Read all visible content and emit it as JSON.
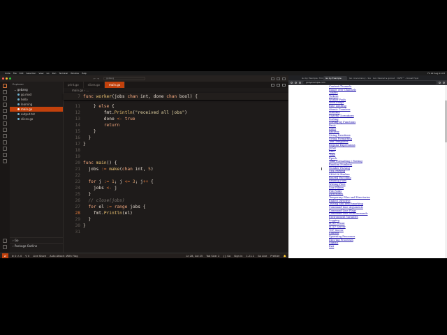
{
  "menubar": {
    "items": [
      "Code",
      "File",
      "Edit",
      "Selection",
      "View",
      "Go",
      "Run",
      "Terminal",
      "Window",
      "Help"
    ],
    "right": [
      "Fri 22 Aug 11:03"
    ]
  },
  "vscode": {
    "nav": "← →",
    "search_placeholder": "gobang",
    "sidebar": {
      "header": "Explorer",
      "folder": "gobang",
      "files": [
        {
          "name": "go.mod",
          "selected": false
        },
        {
          "name": "hello",
          "selected": false
        },
        {
          "name": "learning",
          "selected": false
        },
        {
          "name": "main.go",
          "selected": true
        },
        {
          "name": "output.txt",
          "selected": false
        },
        {
          "name": "slices.go",
          "selected": false
        }
      ],
      "go_section": "Go",
      "outline_section": "Package Outline"
    },
    "tabs": [
      {
        "label": "print.go",
        "active": false
      },
      {
        "label": "slices.go",
        "active": false
      },
      {
        "label": "main.go",
        "active": true
      }
    ],
    "breadcrumb": "main.go › ...",
    "code_lines": [
      {
        "n": "7",
        "html": "<span class='kw'>func</span> <span class='fn'>worker</span>(jobs <span class='kw'>chan</span> int, done <span class='kw'>chan</span> bool) {"
      },
      {
        "n": "11",
        "html": "    } <span class='kw'>else</span> {"
      },
      {
        "n": "12",
        "html": "        fmt.<span class='fn'>Println</span>(<span class='str'>\"received all jobs\"</span>)"
      },
      {
        "n": "13",
        "html": "        done <span class='op'>&lt;-</span> <span class='kw'>true</span>"
      },
      {
        "n": "14",
        "html": "        <span class='kw'>return</span>"
      },
      {
        "n": "15",
        "html": "    }"
      },
      {
        "n": "16",
        "html": "  }"
      },
      {
        "n": "17",
        "html": "}"
      },
      {
        "n": "18",
        "html": ""
      },
      {
        "n": "19",
        "html": ""
      },
      {
        "n": "20",
        "html": "<span class='kw'>func</span> <span class='fn'>main</span>() {"
      },
      {
        "n": "21",
        "html": "  jobs <span class='op'>:=</span> <span class='fn'>make</span>(<span class='kw'>chan</span> int, <span class='num'>5</span>)"
      },
      {
        "n": "22",
        "html": ""
      },
      {
        "n": "23",
        "html": "  <span class='kw'>for</span> j <span class='op'>:=</span> <span class='num'>1</span>; j <span class='op'>&lt;=</span> <span class='num'>3</span>; j<span class='op'>++</span> {"
      },
      {
        "n": "24",
        "html": "    jobs <span class='op'>&lt;-</span> j"
      },
      {
        "n": "25",
        "html": "  }"
      },
      {
        "n": "26",
        "html": "  <span class='cm'>// close(jobs)</span>"
      },
      {
        "n": "27",
        "html": "  <span class='kw'>for</span> el <span class='op'>:=</span> <span class='kw'>range</span> jobs {"
      },
      {
        "n": "28",
        "html": "    fmt.<span class='fn'>Println</span>(el)"
      },
      {
        "n": "29",
        "html": "  }"
      },
      {
        "n": "30",
        "html": "}"
      },
      {
        "n": "31",
        "html": ""
      }
    ],
    "current_line": "28",
    "status": {
      "left": [
        "⊗ 0 ⚠ 0",
        "⚲ 0",
        "Live Share",
        "Auto Attach: With Flag"
      ],
      "right": [
        "Ln 28, Col 25",
        "Tab Size: 2",
        "{} Go",
        "Sign in",
        "1.21.1",
        "Go Live",
        "Prettier"
      ]
    }
  },
  "browser": {
    "tabs": [
      {
        "label": "Go by Example: Timers",
        "active": false
      },
      {
        "label": "Go by Example",
        "active": true
      },
      {
        "label": "Go concurrency - Sonia Ka",
        "active": false
      },
      {
        "label": "Go channel & goroutine",
        "active": false
      },
      {
        "label": "YAIFE™ - Knowit Syste",
        "active": false
      }
    ],
    "url": "gobyexample.com",
    "examples": [
      "Context Channels",
      "Range over Channels",
      "Timers",
      "Tickers",
      "Worker Pools",
      "WaitGroups",
      "Rate Limiting",
      "Atomic Counters",
      "Mutexes",
      "Stateful Goroutines",
      "Sorting",
      "Sorting by Functions",
      "Panic",
      "Defer",
      "Recover",
      "String Functions",
      "String Formatting",
      "Text Templates",
      "Regular Expressions",
      "JSON",
      "XML",
      "Time",
      "Epoch",
      "Time Formatting / Parsing",
      "Random Numbers",
      "Number Parsing",
      "URL Parsing",
      "SHA256 Hashes",
      "Base64 Encoding",
      "Reading Files",
      "Writing Files",
      "Line Filters",
      "File Paths",
      "Directories",
      "Temporary Files and Directories",
      "Embed Directive",
      "Testing and Benchmarking",
      "Command-Line Arguments",
      "Command-Line Flags",
      "Command-Line Subcommands",
      "Environment Variables",
      "Logging",
      "HTTP Client",
      "HTTP Server",
      "TCP Server",
      "Context",
      "Spawning Processes",
      "Exec'ing Processes",
      "Signals",
      "Exit"
    ]
  },
  "colors": {
    "accent": "#c2410c",
    "editor_bg": "#1e1b1a",
    "link": "#1a0dab"
  }
}
